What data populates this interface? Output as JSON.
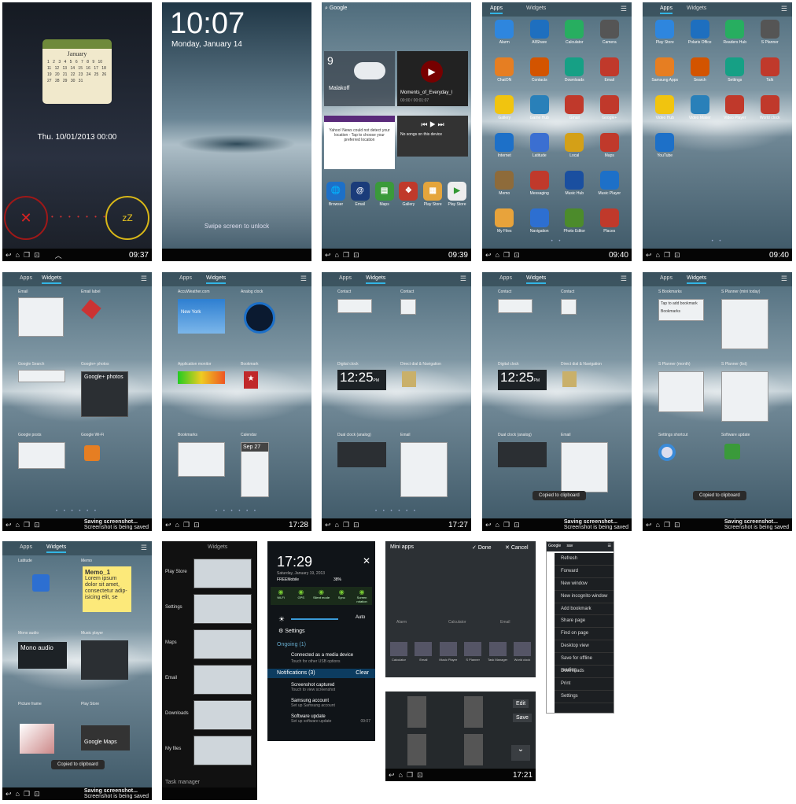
{
  "row1": {
    "s1": {
      "cal_month": "January",
      "cal_days": "1 2 3 4 5 6 7 8 9 10 11 12 13 14 15 16 17 18 19 20 21 22 23 24 25 26 27 28 29 30 31",
      "date": "Thu. 10/01/2013 00:00",
      "snooze": "zZ",
      "clock": "09:37"
    },
    "s2": {
      "time": "10:07",
      "date": "Monday, January 14",
      "swipe": "Swipe screen to unlock"
    },
    "s3": {
      "search": "Google",
      "weather_temp": "9",
      "weather_city": "Malakoff",
      "video_title": "Moments_of_Everyday_l",
      "video_time": "00:00 / 00:01:07",
      "news_text": "Yahoo! News could not detect your location - Tap to choose your preferred location",
      "music_title": "No songs on this device",
      "clock": "09:39",
      "dock": [
        "Browser",
        "Email",
        "Maps",
        "Gallery",
        "Play Store",
        "Play Store"
      ]
    },
    "s4": {
      "tab_apps": "Apps",
      "tab_widgets": "Widgets",
      "apps": [
        "Alarm",
        "AllShare",
        "Calculator",
        "Camera",
        "ChatON",
        "Contacts",
        "Downloads",
        "Email",
        "Gallery",
        "Game Hub",
        "Gmail",
        "Google+",
        "Internet",
        "Latitude",
        "Local",
        "Maps",
        "Memo",
        "Messaging",
        "Music Hub",
        "Music Player",
        "My Files",
        "Navigation",
        "Photo Editor",
        "Places"
      ],
      "clock": "09:40"
    },
    "s5": {
      "tab_apps": "Apps",
      "tab_widgets": "Widgets",
      "apps": [
        "Play Store",
        "Polaris Office",
        "Readers Hub",
        "S Planner",
        "Samsung Apps",
        "Search",
        "Settings",
        "Talk",
        "Video Hub",
        "Video Maker",
        "Video Player",
        "World clock",
        "YouTube"
      ],
      "clock": "09:40"
    }
  },
  "row2": {
    "w1": {
      "tab_apps": "Apps",
      "tab_widgets": "Widgets",
      "labels": [
        "Email",
        "Email label",
        "Google Search",
        "Google+ photos",
        "Google posts",
        "Google Wi-Fi"
      ],
      "gplus": "Google+ photos",
      "status": "Saving screenshot...",
      "status_sub": "Screenshot is being saved"
    },
    "w2": {
      "tab_apps": "Apps",
      "tab_widgets": "Widgets",
      "labels": [
        "AccuWeather.com",
        "Analog clock",
        "Application monitor",
        "Bookmark",
        "Bookmarks",
        "Calendar"
      ],
      "weather_city": "New York",
      "clock": "17:28",
      "cal_day": "Sep 27"
    },
    "w3": {
      "tab_apps": "Apps",
      "tab_widgets": "Widgets",
      "labels": [
        "Contact",
        "Contact",
        "Digital clock",
        "Direct dial & Navigation",
        "Dual clock (analog)",
        "Email"
      ],
      "digital": "12:25",
      "pm": "PM",
      "clock": "17:27"
    },
    "w4": {
      "tab_apps": "Apps",
      "tab_widgets": "Widgets",
      "labels": [
        "Contact",
        "Contact",
        "Digital clock",
        "Direct dial & Navigation",
        "Dual clock (analog)",
        "Email"
      ],
      "digital": "12:25",
      "pm": "PM",
      "toast": "Copied to clipboard",
      "status": "Saving screenshot...",
      "status_sub": "Screenshot is being saved"
    },
    "w5": {
      "tab_apps": "Apps",
      "tab_widgets": "Widgets",
      "labels": [
        "S Bookmarks",
        "S Planner (mini today)",
        "S Planner (month)",
        "S Planner (list)",
        "Settings shortcut",
        "Software update"
      ],
      "toast": "Copied to clipboard",
      "status": "Saving screenshot...",
      "status_sub": "Screenshot is being saved",
      "bm_add": "Tap to add bookmark",
      "bm_title": "Bookmarks"
    }
  },
  "row3": {
    "x1": {
      "tab_apps": "Apps",
      "tab_widgets": "Widgets",
      "labels": [
        "Latitude",
        "Memo",
        "Mono audio",
        "Music player",
        "Picture frame",
        "Play Store"
      ],
      "memo_title": "Memo_1",
      "memo_body": "Lorem ipsum dolor sit amet, consectetur adip-isicing elit, se",
      "mono": "Mono audio",
      "maps": "Google Maps",
      "toast": "Copied to clipboard",
      "status": "Saving screenshot...",
      "status_sub": "Screenshot is being saved"
    },
    "x2": {
      "header": "Widgets",
      "items": [
        "Play Store",
        "Settings",
        "Maps",
        "Email",
        "Downloads",
        "My files"
      ],
      "footer": "Task manager"
    },
    "x3": {
      "time": "17:29",
      "date": "Saturday, January 19, 2013",
      "network": "FREEMobile",
      "battery": "38%",
      "toggles": [
        "Wi-Fi",
        "GPS",
        "Silent mode",
        "Sync",
        "Screen rotation"
      ],
      "auto": "Auto",
      "settings": "Settings",
      "ongoing": "Ongoing (1)",
      "media_title": "Connected as a media device",
      "media_sub": "Touch for other USB options",
      "notif": "Notifications (3)",
      "clear": "Clear",
      "n1": "Screenshot captured",
      "n1sub": "Touch to view screenshot",
      "n2": "Samsung account",
      "n2sub": "Set up Samsung account",
      "n3": "Software update",
      "n3sub": "Set up software update",
      "n3time": "09:07"
    },
    "x4": {
      "title": "Mini apps",
      "done": "Done",
      "cancel": "Cancel",
      "apps": [
        "Alarm",
        "Calculator",
        "Email"
      ],
      "tray": [
        "Calculator",
        "Email",
        "Music Player",
        "S Planner",
        "Task Manager",
        "World clock"
      ]
    },
    "x5": {
      "edit": "Edit",
      "save": "Save",
      "clock": "17:21"
    },
    "x6": {
      "tab1": "Google",
      "tab2": "sav",
      "items": [
        "Refresh",
        "Forward",
        "New window",
        "New incognito window",
        "Add bookmark",
        "Share page",
        "Find on page",
        "Desktop view",
        "Save for offline reading",
        "Downloads",
        "Print",
        "Settings"
      ]
    }
  }
}
